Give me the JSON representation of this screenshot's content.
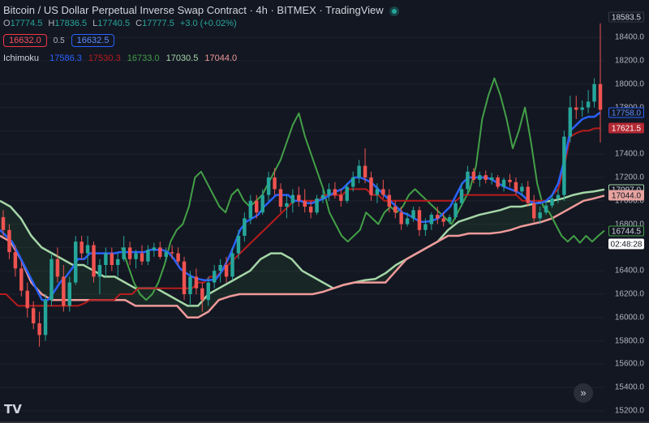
{
  "header": {
    "title": "Bitcoin / US Dollar Perpetual Inverse Swap Contract · 4h · BITMEX · TradingView",
    "status_color": "#26a69a"
  },
  "ohlc": {
    "o_label": "O",
    "o": "17774.5",
    "h_label": "H",
    "h": "17836.5",
    "l_label": "L",
    "l": "17740.5",
    "c_label": "C",
    "c": "17777.5",
    "change": "+3.0 (+0.02%)"
  },
  "trade": {
    "sell": "16632.0",
    "spread": "0.5",
    "buy": "16632.5"
  },
  "indicator": {
    "name": "Ichimoku",
    "conversion": "17586.3",
    "base": "17530.3",
    "lagging": "16733.0",
    "lead_a": "17030.5",
    "lead_b": "17044.0"
  },
  "price_axis": {
    "ticks": [
      "18400.0",
      "18200.0",
      "18000.0",
      "17800.0",
      "17600.0",
      "17400.0",
      "17200.0",
      "17000.0",
      "16800.0",
      "16600.0",
      "16400.0",
      "16200.0",
      "16000.0",
      "15800.0",
      "15600.0",
      "15400.0",
      "15200.0"
    ],
    "high_label": "18583.5",
    "tags": [
      {
        "name": "conversion-line-tag",
        "text": "17758.0",
        "value": 17758,
        "bg": "#131722",
        "border": "#2962ff",
        "color": "#5b8cff"
      },
      {
        "name": "base-line-tag",
        "text": "17621.5",
        "value": 17621.5,
        "bg": "#b22833",
        "border": "#b22833",
        "color": "#ffffff"
      },
      {
        "name": "lead-a-tag",
        "text": "17097.0",
        "value": 17097,
        "bg": "#131722",
        "border": "#a5d6a7",
        "color": "#d1d4dc"
      },
      {
        "name": "lead-b-tag",
        "text": "17044.0",
        "value": 17044,
        "bg": "#e7a3a0",
        "border": "#e7a3a0",
        "color": "#131722"
      },
      {
        "name": "lagging-span-tag",
        "text": "16744.5",
        "value": 16744.5,
        "bg": "#131722",
        "border": "#43a047",
        "color": "#d1d4dc"
      }
    ],
    "countdown": "02:48:28"
  },
  "colors": {
    "up": "#26a69a",
    "down": "#ef5350",
    "conversion": "#2962ff",
    "base": "#b71c1c",
    "lagging": "#43a047",
    "lead_a": "#a5d6a7",
    "lead_b": "#ef9a9a"
  },
  "logo": "TV",
  "go_to_realtime_icon": "double-chevron-right-icon",
  "chart_data": {
    "type": "candlestick",
    "ylim": [
      15150,
      18600
    ],
    "candles": [
      [
        16860,
        16920,
        16700,
        16750
      ],
      [
        16750,
        16800,
        16500,
        16560
      ],
      [
        16560,
        16620,
        16350,
        16420
      ],
      [
        16420,
        16480,
        16180,
        16230
      ],
      [
        16230,
        16300,
        16000,
        16080
      ],
      [
        16080,
        16140,
        15900,
        15950
      ],
      [
        15950,
        16050,
        15750,
        15850
      ],
      [
        15850,
        16200,
        15800,
        16150
      ],
      [
        16150,
        16550,
        16100,
        16500
      ],
      [
        16500,
        16600,
        16300,
        16350
      ],
      [
        16350,
        16450,
        16050,
        16100
      ],
      [
        16100,
        16350,
        16050,
        16300
      ],
      [
        16300,
        16700,
        16280,
        16650
      ],
      [
        16650,
        16700,
        16500,
        16550
      ],
      [
        16550,
        16700,
        16450,
        16620
      ],
      [
        16620,
        16650,
        16300,
        16350
      ],
      [
        16350,
        16500,
        16200,
        16450
      ],
      [
        16450,
        16600,
        16350,
        16550
      ],
      [
        16550,
        16600,
        16400,
        16450
      ],
      [
        16450,
        16550,
        16350,
        16500
      ],
      [
        16500,
        16700,
        16480,
        16600
      ],
      [
        16600,
        16650,
        16450,
        16500
      ],
      [
        16500,
        16580,
        16420,
        16550
      ],
      [
        16550,
        16620,
        16450,
        16480
      ],
      [
        16480,
        16620,
        16450,
        16580
      ],
      [
        16580,
        16640,
        16520,
        16600
      ],
      [
        16600,
        16650,
        16500,
        16520
      ],
      [
        16520,
        16600,
        16480,
        16560
      ],
      [
        16560,
        16620,
        16500,
        16550
      ],
      [
        16550,
        16600,
        16450,
        16480
      ],
      [
        16480,
        16520,
        16150,
        16200
      ],
      [
        16200,
        16400,
        16100,
        16350
      ],
      [
        16350,
        16420,
        16200,
        16250
      ],
      [
        16250,
        16300,
        16050,
        16150
      ],
      [
        16150,
        16350,
        16100,
        16300
      ],
      [
        16300,
        16450,
        16250,
        16400
      ],
      [
        16400,
        16500,
        16300,
        16450
      ],
      [
        16450,
        16520,
        16300,
        16350
      ],
      [
        16350,
        16600,
        16320,
        16550
      ],
      [
        16550,
        16750,
        16500,
        16700
      ],
      [
        16700,
        16900,
        16650,
        16850
      ],
      [
        16850,
        17050,
        16800,
        17000
      ],
      [
        17000,
        17050,
        16850,
        16900
      ],
      [
        16900,
        17100,
        16880,
        17050
      ],
      [
        17050,
        17250,
        17000,
        17200
      ],
      [
        17200,
        17280,
        17050,
        17100
      ],
      [
        17100,
        17150,
        16900,
        16950
      ],
      [
        16950,
        17050,
        16850,
        16980
      ],
      [
        16980,
        17100,
        16900,
        17050
      ],
      [
        17050,
        17120,
        16950,
        17000
      ],
      [
        17000,
        17100,
        16900,
        16950
      ],
      [
        16950,
        17000,
        16850,
        16900
      ],
      [
        16900,
        17050,
        16880,
        17020
      ],
      [
        17020,
        17100,
        16980,
        17050
      ],
      [
        17050,
        17150,
        17000,
        17100
      ],
      [
        17100,
        17160,
        17020,
        17050
      ],
      [
        17050,
        17100,
        16950,
        17000
      ],
      [
        17000,
        17150,
        16980,
        17120
      ],
      [
        17120,
        17250,
        17080,
        17200
      ],
      [
        17200,
        17350,
        17150,
        17300
      ],
      [
        17300,
        17450,
        17150,
        17200
      ],
      [
        17200,
        17250,
        17000,
        17050
      ],
      [
        17050,
        17150,
        16980,
        17100
      ],
      [
        17100,
        17180,
        17020,
        17050
      ],
      [
        17050,
        17100,
        16900,
        16950
      ],
      [
        16950,
        17000,
        16850,
        16900
      ],
      [
        16900,
        16950,
        16750,
        16800
      ],
      [
        16800,
        16900,
        16780,
        16850
      ],
      [
        16850,
        16950,
        16820,
        16920
      ],
      [
        16920,
        16950,
        16700,
        16750
      ],
      [
        16750,
        16850,
        16700,
        16800
      ],
      [
        16800,
        16900,
        16750,
        16880
      ],
      [
        16880,
        16950,
        16800,
        16850
      ],
      [
        16850,
        16900,
        16780,
        16820
      ],
      [
        16820,
        16880,
        16800,
        16860
      ],
      [
        16860,
        17000,
        16840,
        16980
      ],
      [
        16980,
        17150,
        16950,
        17100
      ],
      [
        17100,
        17300,
        17050,
        17250
      ],
      [
        17250,
        17280,
        17150,
        17180
      ],
      [
        17180,
        17250,
        17120,
        17220
      ],
      [
        17220,
        17260,
        17150,
        17180
      ],
      [
        17180,
        17240,
        17140,
        17200
      ],
      [
        17200,
        17220,
        17100,
        17120
      ],
      [
        17120,
        17200,
        17080,
        17180
      ],
      [
        17180,
        17230,
        17120,
        17160
      ],
      [
        17160,
        17200,
        17050,
        17080
      ],
      [
        17080,
        17150,
        17040,
        17120
      ],
      [
        17120,
        17170,
        16950,
        16980
      ],
      [
        16980,
        17050,
        16820,
        16850
      ],
      [
        16850,
        16950,
        16800,
        16900
      ],
      [
        16900,
        17000,
        16880,
        16960
      ],
      [
        16960,
        17050,
        16940,
        17020
      ],
      [
        17020,
        17100,
        16980,
        17050
      ],
      [
        17050,
        17600,
        17000,
        17550
      ],
      [
        17550,
        17900,
        17500,
        17800
      ],
      [
        17800,
        17900,
        17700,
        17780
      ],
      [
        17780,
        17860,
        17720,
        17800
      ],
      [
        17800,
        17950,
        17750,
        17850
      ],
      [
        17850,
        18050,
        17800,
        18000
      ],
      [
        18000,
        18300,
        17500,
        17780
      ]
    ],
    "series": [
      {
        "name": "Conversion",
        "values": [
          16750,
          16700,
          16650,
          16550,
          16450,
          16350,
          16250,
          16150,
          16150,
          16220,
          16300,
          16350,
          16420,
          16500,
          16500,
          16550,
          16550,
          16550,
          16550,
          16550,
          16560,
          16560,
          16560,
          16560,
          16560,
          16580,
          16580,
          16580,
          16560,
          16500,
          16420,
          16380,
          16350,
          16330,
          16320,
          16320,
          16330,
          16400,
          16500,
          16620,
          16750,
          16820,
          16850,
          16880,
          16950,
          17000,
          17050,
          17050,
          17050,
          17000,
          17000,
          16980,
          16980,
          17000,
          17020,
          17050,
          17080,
          17100,
          17150,
          17200,
          17200,
          17180,
          17150,
          17100,
          17050,
          17000,
          16950,
          16900,
          16880,
          16850,
          16820,
          16820,
          16830,
          16850,
          16900,
          16950,
          17050,
          17150,
          17200,
          17200,
          17200,
          17200,
          17180,
          17150,
          17120,
          17100,
          17080,
          17050,
          17000,
          16980,
          16980,
          17000,
          17050,
          17150,
          17350,
          17600,
          17650,
          17700,
          17720,
          17720,
          17758
        ]
      },
      {
        "name": "Base",
        "values": [
          16200,
          16200,
          16150,
          16100,
          16100,
          16100,
          16100,
          16100,
          16100,
          16100,
          16100,
          16100,
          16100,
          16100,
          16120,
          16150,
          16150,
          16150,
          16150,
          16150,
          16200,
          16200,
          16200,
          16250,
          16250,
          16250,
          16250,
          16250,
          16250,
          16250,
          16250,
          16250,
          16250,
          16300,
          16300,
          16350,
          16350,
          16400,
          16450,
          16500,
          16550,
          16600,
          16650,
          16700,
          16750,
          16800,
          16850,
          16900,
          16950,
          17000,
          17000,
          17000,
          17000,
          17000,
          17050,
          17050,
          17050,
          17050,
          17100,
          17100,
          17100,
          17100,
          17050,
          17050,
          17000,
          17000,
          17000,
          17000,
          17000,
          17000,
          17000,
          17000,
          17000,
          17000,
          17000,
          17000,
          17000,
          17050,
          17050,
          17050,
          17050,
          17050,
          17050,
          17050,
          17050,
          17050,
          17050,
          17000,
          17000,
          17000,
          17000,
          17000,
          17050,
          17100,
          17300,
          17550,
          17580,
          17600,
          17600,
          17620,
          17621.5
        ]
      },
      {
        "name": "Lagging",
        "values": [
          16600,
          16450,
          16300,
          16200,
          16150,
          16200,
          16300,
          16450,
          16650,
          16750,
          16800,
          16950,
          17200,
          17250,
          17150,
          17050,
          16950,
          16900,
          17050,
          17100,
          17000,
          16950,
          17000,
          17050,
          17150,
          17250,
          17350,
          17500,
          17650,
          17750,
          17550,
          17400,
          17250,
          17100,
          16900,
          16800,
          16700,
          16650,
          16700,
          16750,
          16900,
          16850,
          16800,
          16900,
          16950,
          16900,
          16950,
          17050,
          17100,
          17050,
          17000,
          16950,
          16900,
          16850,
          16800,
          16900,
          17000,
          17100,
          17300,
          17700,
          17900,
          18050,
          17900,
          17700,
          17450,
          17600,
          17800,
          17500,
          17150,
          16950,
          16900,
          16800,
          16700,
          16650,
          16700,
          16640,
          16700,
          16650,
          16700,
          16744.5
        ]
      },
      {
        "name": "Lead A",
        "values": [
          17000,
          16950,
          16850,
          16700,
          16600,
          16550,
          16500,
          16450,
          16450,
          16400,
          16350,
          16350,
          16300,
          16250,
          16250,
          16250,
          16200,
          16150,
          16100,
          16100,
          16200,
          16250,
          16300,
          16350,
          16400,
          16500,
          16550,
          16550,
          16500,
          16400,
          16350,
          16300,
          16250,
          16280,
          16300,
          16320,
          16330,
          16380,
          16450,
          16500,
          16550,
          16600,
          16650,
          16750,
          16820,
          16850,
          16880,
          16900,
          16920,
          16950,
          16950,
          16970,
          16990,
          17000,
          17020,
          17050,
          17070,
          17080,
          17097
        ]
      },
      {
        "name": "Lead B",
        "values": [
          16700,
          16650,
          16500,
          16300,
          16200,
          16150,
          16150,
          16150,
          16150,
          16150,
          16150,
          16150,
          16150,
          16100,
          16100,
          16100,
          16100,
          16100,
          16000,
          16000,
          16050,
          16150,
          16180,
          16200,
          16200,
          16200,
          16200,
          16200,
          16200,
          16200,
          16200,
          16220,
          16250,
          16280,
          16300,
          16300,
          16300,
          16300,
          16400,
          16500,
          16550,
          16600,
          16650,
          16700,
          16700,
          16720,
          16720,
          16720,
          16730,
          16750,
          16780,
          16800,
          16820,
          16850,
          16900,
          16950,
          17000,
          17020,
          17044
        ]
      }
    ]
  }
}
